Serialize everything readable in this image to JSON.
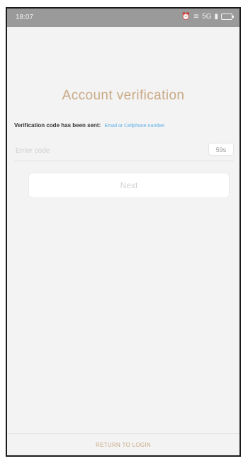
{
  "status_bar": {
    "time": "18:07",
    "icons": [
      "alarm-icon",
      "wifi-icon",
      "signal-icon",
      "battery-icon"
    ],
    "signal_text": "5G"
  },
  "page": {
    "title": "Account verification",
    "sent_label": "Verification code has been sent:",
    "sent_target": "Email or Cellphone number",
    "code_placeholder": "Enter code",
    "countdown": "59s",
    "next_button": "Next",
    "return_link": "RETURN TO LOGIN"
  },
  "colors": {
    "accent": "#c9a985",
    "link_blue": "#58aee8",
    "background": "#f3f3f3",
    "status_bar": "#9a9a9a"
  }
}
